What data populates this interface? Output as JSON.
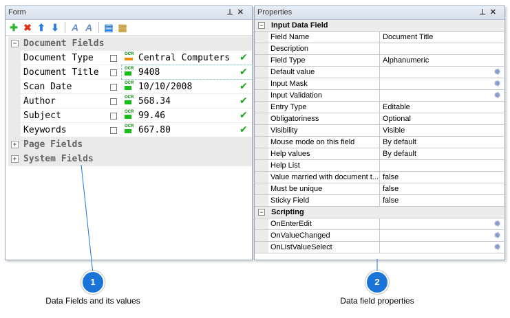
{
  "form": {
    "title": "Form",
    "pin": "⊥",
    "close": "✕",
    "toolbar": [
      "add-icon",
      "delete-icon",
      "move-up-icon",
      "move-down-icon",
      "remove-field-icon",
      "add-field-icon",
      "field-help-icon",
      "properties-icon"
    ],
    "groups": {
      "document": "Document Fields",
      "page": "Page Fields",
      "system": "System Fields"
    },
    "fields": [
      {
        "name": "Document Type",
        "value": "Central Computers",
        "ocr": "OCR",
        "color": "#f08c00"
      },
      {
        "name": "Document Title",
        "value": "9408",
        "ocr": "OCR",
        "color": "#17c017"
      },
      {
        "name": "Scan Date",
        "value": "10/10/2008",
        "ocr": "OCR",
        "color": "#17c017"
      },
      {
        "name": "Author",
        "value": "568.34",
        "ocr": "OCR",
        "color": "#17c017"
      },
      {
        "name": "Subject",
        "value": "99.46",
        "ocr": "OCR",
        "color": "#17c017"
      },
      {
        "name": "Keywords",
        "value": "667.80",
        "ocr": "OCR",
        "color": "#17c017"
      }
    ]
  },
  "properties": {
    "title": "Properties",
    "section1": "Input Data Field",
    "rows1": [
      {
        "name": "Field Name",
        "value": "Document Title"
      },
      {
        "name": "Description",
        "value": ""
      },
      {
        "name": "Field Type",
        "value": "Alphanumeric"
      },
      {
        "name": "Default value",
        "value": "",
        "gear": true
      },
      {
        "name": "Input Mask",
        "value": "",
        "gear": true
      },
      {
        "name": "Input Validation",
        "value": "",
        "gear": true
      },
      {
        "name": "Entry Type",
        "value": "Editable"
      },
      {
        "name": "Obligatoriness",
        "value": "Optional"
      },
      {
        "name": "Visibility",
        "value": "Visible"
      },
      {
        "name": "Mouse mode on this field",
        "value": "By default"
      },
      {
        "name": "Help values",
        "value": "By default"
      },
      {
        "name": "Help List",
        "value": ""
      },
      {
        "name": "Value married with document t...",
        "value": "false"
      },
      {
        "name": "Must be unique",
        "value": "false"
      },
      {
        "name": "Sticky Field",
        "value": "false"
      }
    ],
    "section2": "Scripting",
    "rows2": [
      {
        "name": "OnEnterEdit",
        "value": "",
        "gear": true
      },
      {
        "name": "OnValueChanged",
        "value": "",
        "gear": true
      },
      {
        "name": "OnListValueSelect",
        "value": "",
        "gear": true
      }
    ]
  },
  "callouts": [
    {
      "num": "1",
      "label": "Data Fields and its values"
    },
    {
      "num": "2",
      "label": "Data field properties"
    }
  ]
}
